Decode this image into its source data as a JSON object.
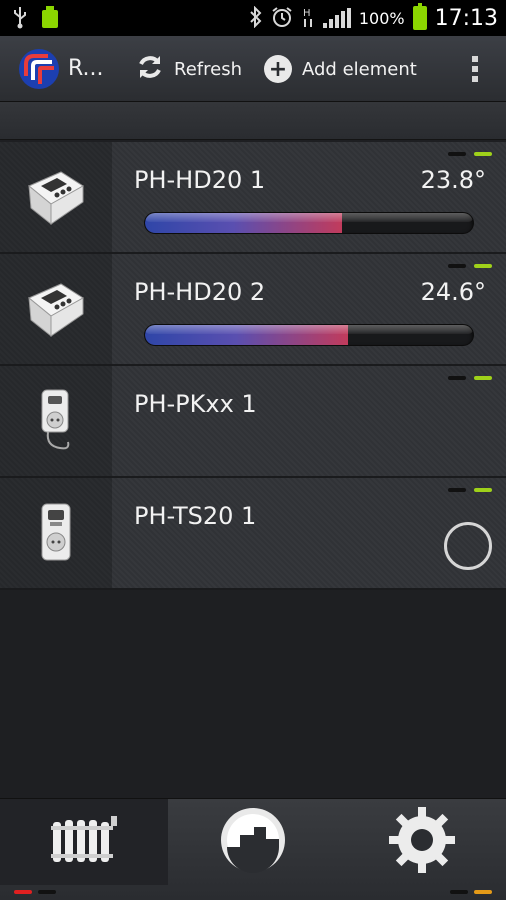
{
  "status_bar": {
    "battery_percent": "100%",
    "time": "17:13",
    "icons": [
      "usb-icon",
      "battery-full-icon",
      "bluetooth-icon",
      "alarm-icon",
      "hspa-icon",
      "signal-icon"
    ]
  },
  "action_bar": {
    "app_title": "R...",
    "refresh_label": "Refresh",
    "add_label": "Add element"
  },
  "devices": [
    {
      "name": "PH-HD20 1",
      "temp": "23.8°",
      "level": 0.6,
      "type": "thermostat"
    },
    {
      "name": "PH-HD20 2",
      "temp": "24.6°",
      "level": 0.62,
      "type": "thermostat"
    },
    {
      "name": "PH-PKxx 1",
      "temp": "",
      "type": "plug"
    },
    {
      "name": "PH-TS20 1",
      "temp": "",
      "type": "timer-plug"
    }
  ],
  "bottom_nav": {
    "tabs": [
      "radiator",
      "schedule",
      "settings"
    ],
    "active": "radiator"
  },
  "colors": {
    "accent_green": "#9fd11a",
    "red": "#e02020",
    "orange": "#e49a18"
  }
}
